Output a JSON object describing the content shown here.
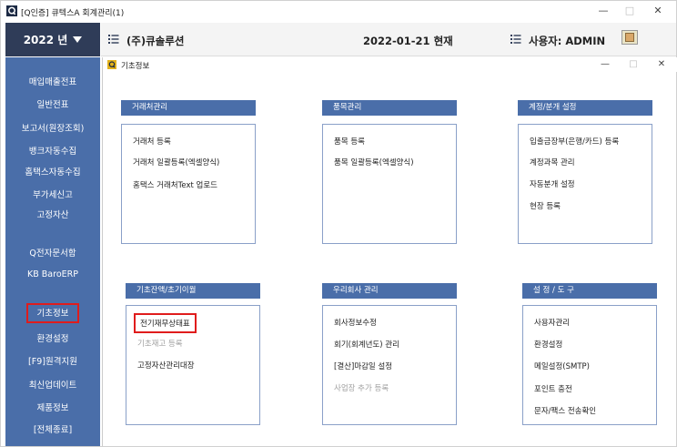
{
  "window": {
    "title": "[Q인증] 큐텍스A   회계관리(1)",
    "minimize": "—",
    "maximize": "□",
    "close": "✕"
  },
  "header": {
    "year_label": "2022 년",
    "company": "(주)큐솔루션",
    "date": "2022-01-21 현재",
    "user": "사용자: ADMIN"
  },
  "sidebar": {
    "items": [
      {
        "label": "매입매출전표"
      },
      {
        "label": "일반전표"
      },
      {
        "label": "보고서(원장조회)"
      },
      {
        "label": "뱅크자동수집"
      },
      {
        "label": "홈택스자동수집"
      },
      {
        "label": "부가세신고"
      },
      {
        "label": "고정자산"
      },
      {
        "label": "Q전자문서함"
      },
      {
        "label": "KB BaroERP"
      },
      {
        "label": "기초정보"
      },
      {
        "label": "환경설정"
      },
      {
        "label": "[F9]원격지원"
      },
      {
        "label": "최신업데이트"
      },
      {
        "label": "제품정보"
      },
      {
        "label": "[전체종료]"
      }
    ],
    "selected": "기초정보"
  },
  "inner_window": {
    "title": "기초정보",
    "minimize": "—",
    "maximize": "□",
    "close": "✕"
  },
  "panels": [
    {
      "title": "거래처관리",
      "items": [
        "거래처 등록",
        "거래처 일괄등록(엑셀양식)",
        "홈택스 거래처Text 업로드"
      ]
    },
    {
      "title": "품목관리",
      "items": [
        "품목 등록",
        "품목 일괄등록(엑셀양식)"
      ]
    },
    {
      "title": "계정/분개 설정",
      "items": [
        "입출금장부(은행/카드) 등록",
        "계정과목 관리",
        "자동분개 설정",
        "현장 등록"
      ]
    },
    {
      "title": "기초잔액/초기이월",
      "items": [
        "전기재무상태표",
        "기초재고 등록",
        "고정자산관리대장"
      ]
    },
    {
      "title": "우리회사 관리",
      "items": [
        "회사정보수정",
        "회기(회계년도) 관리",
        "[결산]마감일 설정",
        "사업장 추가 등록"
      ]
    },
    {
      "title": "설 정 / 도 구",
      "items": [
        "사용자관리",
        "환경설정",
        "메일설정(SMTP)",
        "포인트 충전",
        "문자/팩스 전송확인"
      ]
    }
  ],
  "colors": {
    "sidebar": "#4a6ea9",
    "year_button": "#2f3c58",
    "highlight_border": "#e01c1c",
    "disabled_text": "#a0a0a0"
  }
}
